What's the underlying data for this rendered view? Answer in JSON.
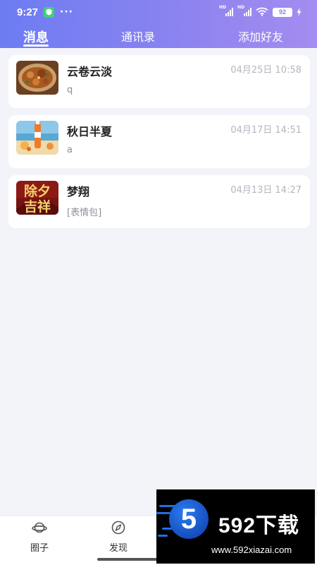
{
  "status_bar": {
    "time": "9:27",
    "dots": "···",
    "battery": "92"
  },
  "tabs": [
    {
      "label": "消息",
      "active": true
    },
    {
      "label": "通讯录",
      "active": false
    },
    {
      "label": "添加好友",
      "active": false
    }
  ],
  "conversations": [
    {
      "name": "云卷云淡",
      "time": "04月25日 10:58",
      "preview": "q",
      "avatar": "food-photo-icon"
    },
    {
      "name": "秋日半夏",
      "time": "04月17日 14:51",
      "preview": "a",
      "avatar": "beach-bottle-photo-icon"
    },
    {
      "name": "梦翔",
      "time": "04月13日 14:27",
      "preview": "[表情包]",
      "avatar": "new-year-calligraphy-icon",
      "avatar_text": "除夕吉祥"
    }
  ],
  "bottom_nav": [
    {
      "label": "圈子",
      "icon": "planet-icon"
    },
    {
      "label": "发现",
      "icon": "compass-icon"
    }
  ],
  "watermark": {
    "badge": "5",
    "brand": "592下载",
    "url": "www.592xiazai.com"
  },
  "colors": {
    "header_start": "#6d7cf2",
    "header_end": "#a58cf0",
    "background": "#f3f4f9"
  }
}
